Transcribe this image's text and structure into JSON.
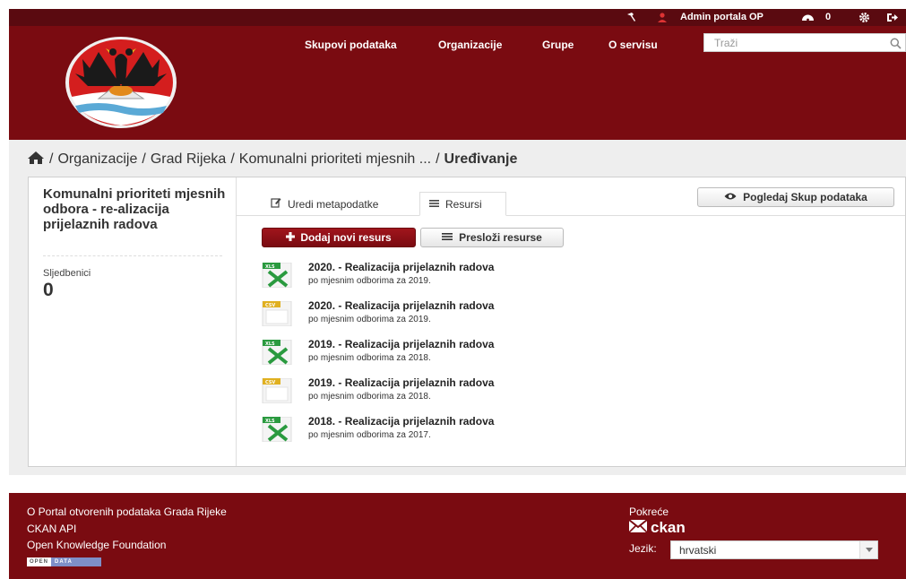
{
  "account": {
    "user_name": "Admin portala OP",
    "activity_count": "0",
    "icons": [
      "sysadmin-hammer-icon",
      "user-icon",
      "dashboard-icon",
      "gear-icon",
      "logout-icon"
    ]
  },
  "nav": {
    "items": [
      "Skupovi podataka",
      "Organizacije",
      "Grupe",
      "O servisu"
    ],
    "search_placeholder": "Traži"
  },
  "breadcrumb": {
    "home_icon": "home-icon",
    "items": [
      "Organizacije",
      "Grad Rijeka",
      "Komunalni prioriteti mjesnih ..."
    ],
    "active": "Uređivanje",
    "separator": "/"
  },
  "sidebar": {
    "title": "Komunalni prioriteti mjesnih odbora - re-alizacija prijelaznih radova",
    "followers_label": "Sljedbenici",
    "followers_count": "0"
  },
  "tabs": [
    {
      "label": "Uredi metapodatke",
      "icon": "edit-icon",
      "active": false
    },
    {
      "label": "Resursi",
      "icon": "list-icon",
      "active": true
    }
  ],
  "actions": {
    "view_dataset": "Pogledaj Skup podataka",
    "add_resource": "Dodaj novi resurs",
    "reorder_resources": "Presloži resurse"
  },
  "resources": [
    {
      "title": "2020. - Realizacija prijelaznih radova",
      "description": "po mjesnim odborima za 2019.",
      "format": "XLS"
    },
    {
      "title": "2020. - Realizacija prijelaznih radova",
      "description": "po mjesnim odborima za 2019.",
      "format": "CSV"
    },
    {
      "title": "2019. - Realizacija prijelaznih radova",
      "description": "po mjesnim odborima za 2018.",
      "format": "XLS"
    },
    {
      "title": "2019. - Realizacija prijelaznih radova",
      "description": "po mjesnim odborima za 2018.",
      "format": "CSV"
    },
    {
      "title": "2018. - Realizacija prijelaznih radova",
      "description": "po mjesnim odborima za 2017.",
      "format": "XLS"
    }
  ],
  "footer": {
    "links": [
      "O Portal otvorenih podataka Grada Rijeke",
      "CKAN API",
      "Open Knowledge Foundation"
    ],
    "badge_left": "OPEN",
    "badge_right": "DATA",
    "powered_by": "Pokreće",
    "ckan": "ckan",
    "language_label": "Jezik:",
    "language_value": "hrvatski"
  },
  "colors": {
    "brand_dark": "#7a0b11",
    "account_bar": "#5a0a10",
    "xls_green": "#2a9a3f",
    "csv_yellow": "#e0b020"
  }
}
